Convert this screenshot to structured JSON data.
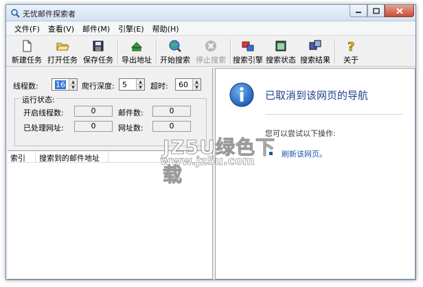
{
  "window": {
    "title": "无忧邮件探索者"
  },
  "menu": [
    {
      "label": "文件(F)"
    },
    {
      "label": "查看(V)"
    },
    {
      "label": "邮件(M)"
    },
    {
      "label": "引擎(E)"
    },
    {
      "label": "帮助(H)"
    }
  ],
  "toolbar": {
    "new_task": "新建任务",
    "open_task": "打开任务",
    "save_task": "保存任务",
    "export_address": "导出地址",
    "start_search": "开始搜索",
    "stop_search": "停止搜索",
    "search_engine": "搜索引擎",
    "search_status": "搜索状态",
    "search_results": "搜索结果",
    "about": "关于"
  },
  "settings": {
    "threads_label": "线程数:",
    "threads_value": "16",
    "depth_label": "爬行深度:",
    "depth_value": "5",
    "timeout_label": "超时:",
    "timeout_value": "60"
  },
  "status": {
    "group_label": "运行状态:",
    "open_threads_label": "开启线程数:",
    "open_threads_value": "0",
    "emails_label": "邮件数:",
    "emails_value": "0",
    "processed_urls_label": "已处理网址:",
    "processed_urls_value": "0",
    "urls_label": "网址数:",
    "urls_value": "0"
  },
  "list": {
    "col_index": "索引",
    "col_email": "搜索到的邮件地址"
  },
  "browser": {
    "title": "已取消到该网页的导航",
    "try_text": "您可以尝试以下操作:",
    "refresh_link": "刷新该网页。"
  },
  "watermark": {
    "line1": "JZ5U绿色下载",
    "line2": "www.jz5u.com"
  },
  "colors": {
    "link": "#1f56b0",
    "heading": "#1f3f8f",
    "info_icon": "#1d5fb8"
  }
}
